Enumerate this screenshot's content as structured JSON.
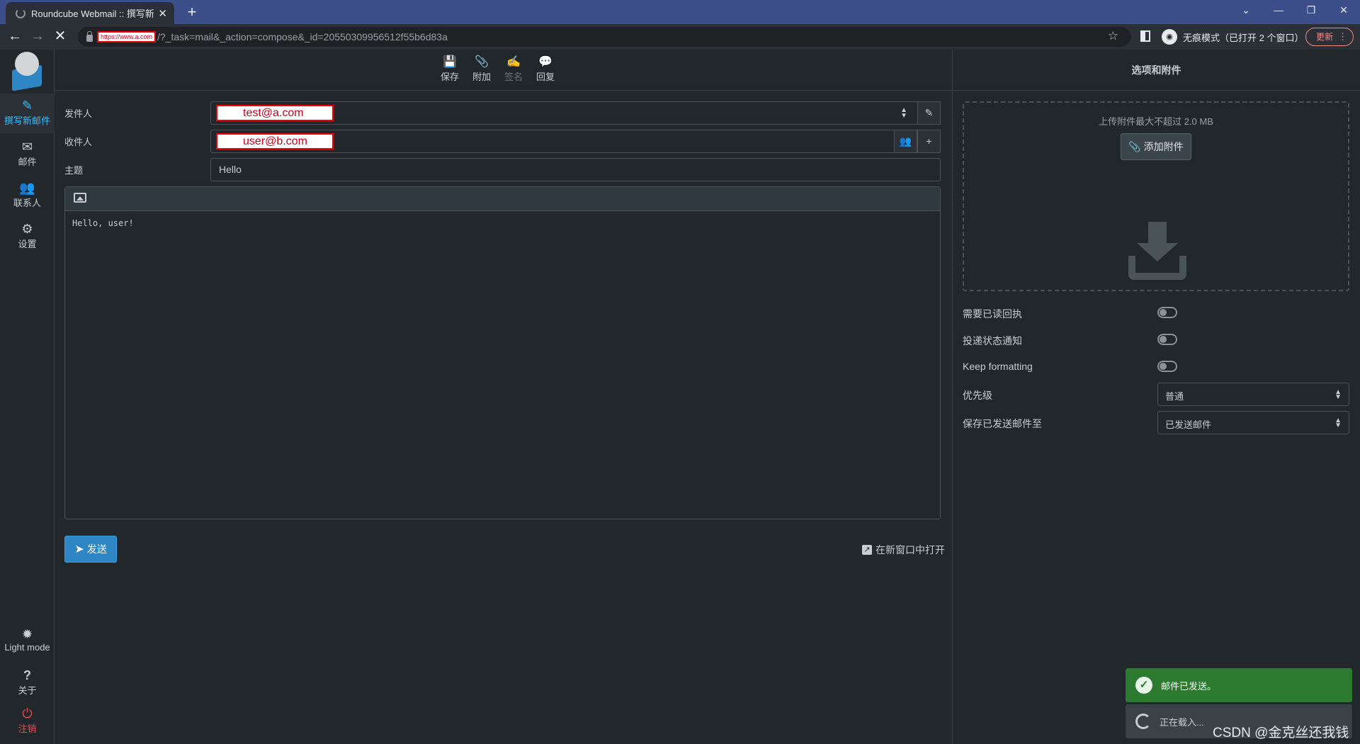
{
  "browser": {
    "tab_title": "Roundcube Webmail :: 撰写新邮件",
    "tab_close": "✕",
    "new_tab": "+",
    "url_host": "https://www.a.com",
    "url_path": "/?_task=mail&_action=compose&_id=20550309956512f55b6d83a",
    "incognito_label": "无痕模式（已打开 2 个窗口）",
    "update_label": "更新",
    "window_controls": [
      "⌄",
      "—",
      "❐",
      "✕"
    ]
  },
  "nav": {
    "compose": "撰写新邮件",
    "mail": "邮件",
    "contacts": "联系人",
    "settings": "设置",
    "light_mode": "Light mode",
    "about": "关于",
    "logout": "注销"
  },
  "toolbar": {
    "save": "保存",
    "attach": "附加",
    "signature": "签名",
    "reply": "回复"
  },
  "form": {
    "from_label": "发件人",
    "from_value": "test@a.com",
    "to_label": "收件人",
    "to_value": "user@b.com",
    "subject_label": "主题",
    "subject_value": "Hello",
    "body": "Hello, user!",
    "send": "发送",
    "open_new_window": "在新窗口中打开"
  },
  "right": {
    "title": "选项和附件",
    "upload_hint": "上传附件最大不超过 2.0 MB",
    "add_attachment": "添加附件",
    "options": {
      "mdn": "需要已读回执",
      "dsn": "投递状态通知",
      "keep_formatting": "Keep formatting",
      "priority_label": "优先级",
      "priority_value": "普通",
      "save_sent_label": "保存已发送邮件至",
      "save_sent_value": "已发送邮件"
    }
  },
  "toasts": {
    "sent": "邮件已发送。",
    "loading": "正在载入..."
  },
  "watermark": "CSDN @金克丝还我钱",
  "colors": {
    "accent": "#37beff",
    "send_button": "#2f86c5",
    "success": "#2b7a2f",
    "logout": "#e54e4e"
  }
}
